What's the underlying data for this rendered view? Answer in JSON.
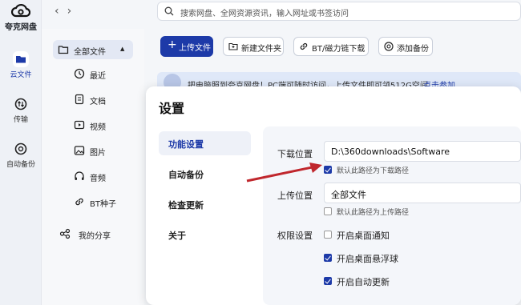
{
  "app": {
    "name": "夸克网盘"
  },
  "rail": {
    "items": [
      {
        "label": "云文件",
        "icon": "folder-icon",
        "active": true
      },
      {
        "label": "传输",
        "icon": "transfer-icon"
      },
      {
        "label": "自动备份",
        "icon": "backup-icon"
      }
    ]
  },
  "topbar": {
    "back": "‹",
    "forward": "›",
    "search_placeholder": "搜索网盘、全网资源资讯，输入网址或书签访问"
  },
  "menu": {
    "all_files": "全部文件",
    "sub_items": [
      {
        "label": "最近",
        "icon": "clock-icon"
      },
      {
        "label": "文档",
        "icon": "document-icon"
      },
      {
        "label": "视频",
        "icon": "video-icon"
      },
      {
        "label": "图片",
        "icon": "image-icon"
      },
      {
        "label": "音频",
        "icon": "headphones-icon"
      },
      {
        "label": "BT种子",
        "icon": "link-icon"
      }
    ],
    "my_share": "我的分享"
  },
  "toolbar": {
    "upload": "上传文件",
    "new_folder": "新建文件夹",
    "bt_download": "BT/磁力链下载",
    "add_backup": "添加备份"
  },
  "banner": {
    "text": "把电脑照到夸克网盘！PC端可随时访问，上传文件即可领512G空间",
    "link": "点击参加"
  },
  "dialog": {
    "title": "设置",
    "nav": [
      "功能设置",
      "自动备份",
      "检查更新",
      "关于"
    ],
    "download_label": "下载位置",
    "download_path": "D:\\360downloads\\Software",
    "download_default": "默认此路径为下载路径",
    "upload_label": "上传位置",
    "upload_path": "全部文件",
    "upload_default": "默认此路径为上传路径",
    "permission_label": "权限设置",
    "permissions": [
      {
        "label": "开启桌面通知",
        "checked": false
      },
      {
        "label": "开启桌面悬浮球",
        "checked": true
      },
      {
        "label": "开启自动更新",
        "checked": true
      }
    ]
  },
  "colors": {
    "accent": "#1d3aa8",
    "annotation_arrow": "#c0272d"
  }
}
